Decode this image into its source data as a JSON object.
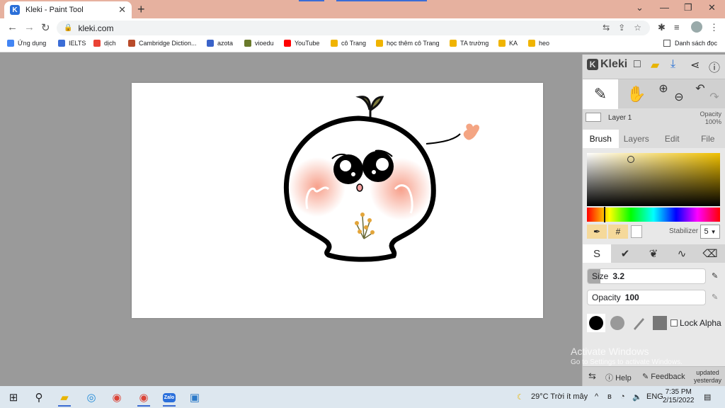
{
  "browser": {
    "tab_title": "Kleki - Paint Tool",
    "tab_close": "✕",
    "new_tab": "+",
    "url": "kleki.com",
    "bookmarks": [
      {
        "label": "Ứng dụng",
        "color": "#4285f4"
      },
      {
        "label": "IELTS",
        "color": "#3b6dd6"
      },
      {
        "label": "dịch",
        "color": "#ea4335"
      },
      {
        "label": "Cambridge Diction...",
        "color": "#b94b2a"
      },
      {
        "label": "azota",
        "color": "#3a63c9"
      },
      {
        "label": "vioedu",
        "color": "#6a7a2b"
      },
      {
        "label": "YouTube",
        "color": "#ff0000"
      },
      {
        "label": "cô Trang",
        "color": "#f0b400"
      },
      {
        "label": "học thêm cô Trang",
        "color": "#f0b400"
      },
      {
        "label": "TA trường",
        "color": "#f0b400"
      },
      {
        "label": "KA",
        "color": "#f0b400"
      },
      {
        "label": "heo",
        "color": "#f0b400"
      }
    ],
    "reading_list": "Danh sách đọc"
  },
  "kleki": {
    "logo": "Kleki",
    "layer_name": "Layer 1",
    "opacity_label": "Opacity",
    "opacity_value": "100%",
    "tabs": [
      "Brush",
      "Layers",
      "Edit",
      "File"
    ],
    "active_tab": "Brush",
    "hash": "#",
    "stabilizer_label": "Stabilizer",
    "stabilizer_value": "5",
    "size_label": "Size",
    "size_value": "3.2",
    "size_fraction": 0.11,
    "opacity_slider_label": "Opacity",
    "opacity_slider_value": "100",
    "lock_alpha": "Lock Alpha",
    "help": "Help",
    "feedback": "Feedback",
    "updated": "updated",
    "updated_when": "yesterday",
    "primary_color": "#000000"
  },
  "watermark": {
    "line1": "Activate Windows",
    "line2": "Go to Settings to activate Windows."
  },
  "taskbar": {
    "weather": "29°C  Trời ít mây",
    "lang": "ENG",
    "time": "7:35 PM",
    "date": "2/15/2022",
    "zalo": "Zalo"
  }
}
